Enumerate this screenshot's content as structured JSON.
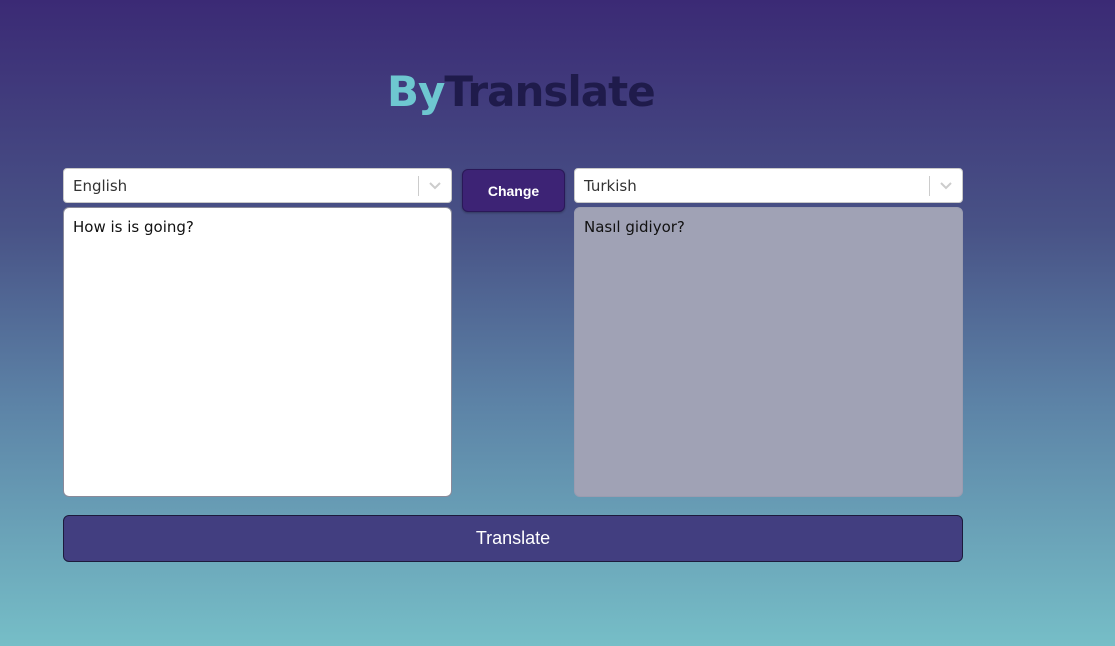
{
  "logo": {
    "part1": "By",
    "part2": "Translate"
  },
  "source": {
    "language": "English",
    "text": "How is is going?"
  },
  "target": {
    "language": "Turkish",
    "text": "Nasıl gidiyor?"
  },
  "buttons": {
    "change_label": "Change",
    "translate_label": "Translate"
  },
  "colors": {
    "logo_accent": "#6ec7d0",
    "logo_dark": "#1f1b4b",
    "change_button": "#3d2375",
    "translate_button": "#423e80",
    "target_panel": "#a0a2b5"
  },
  "icons": {
    "dropdown": "chevron-down-icon"
  }
}
